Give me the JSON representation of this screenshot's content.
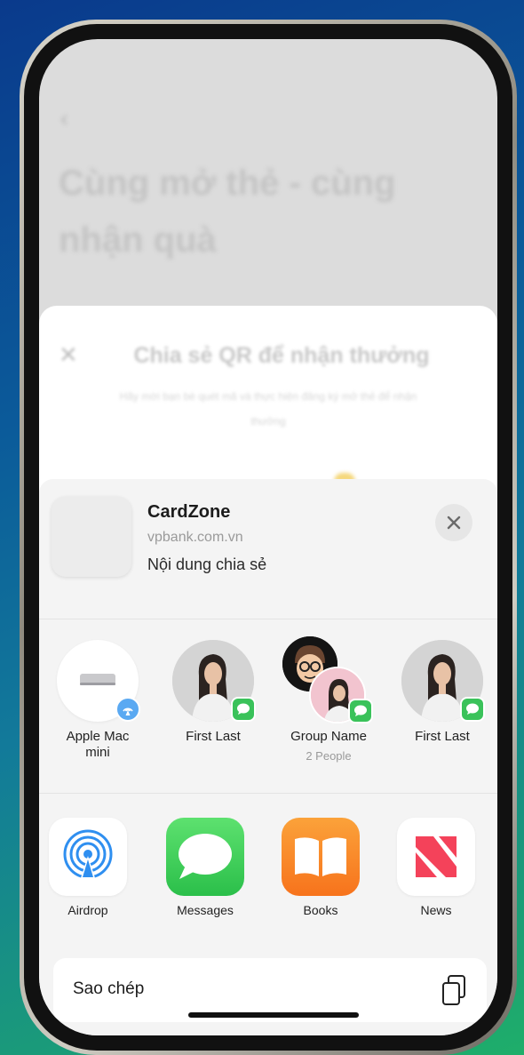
{
  "background_page": {
    "title": "Cùng mở thẻ - cùng nhận quà"
  },
  "modal": {
    "title": "Chia sẻ QR để nhận thưởng",
    "subtitle": "Hãy mời bạn bè quét mã và thực hiện đăng ký mở thẻ để nhận thưởng"
  },
  "share_sheet": {
    "title": "CardZone",
    "url": "vpbank.com.vn",
    "description": "Nội dung chia sẻ",
    "contacts": [
      {
        "name": "Apple Mac mini",
        "sub": "",
        "icon": "airdrop-badge"
      },
      {
        "name": "First Last",
        "sub": "",
        "icon": "messages-badge"
      },
      {
        "name": "Group Name",
        "sub": "2 People",
        "icon": "messages-badge"
      },
      {
        "name": "First Last",
        "sub": "",
        "icon": "messages-badge"
      }
    ],
    "apps": [
      {
        "label": "Airdrop",
        "icon": "airdrop-icon"
      },
      {
        "label": "Messages",
        "icon": "messages-icon"
      },
      {
        "label": "Books",
        "icon": "books-icon"
      },
      {
        "label": "News",
        "icon": "news-icon"
      }
    ],
    "copy_label": "Sao chép"
  },
  "colors": {
    "messages_green": "#3ac25a",
    "books_orange": "#f7831e",
    "news_red": "#f4425a",
    "airdrop_blue": "#2f8ff0"
  }
}
